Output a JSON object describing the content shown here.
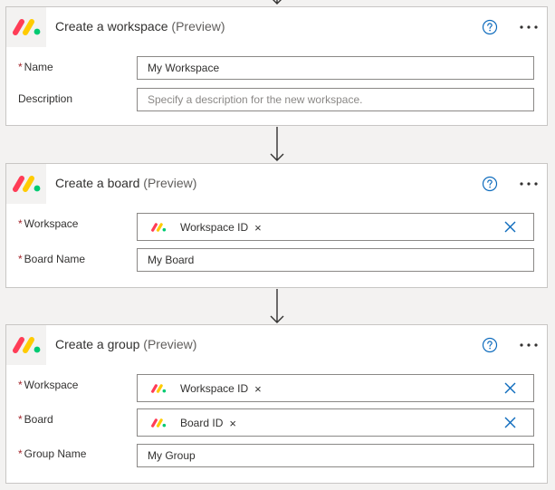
{
  "colors": {
    "accent": "#0f6cbd",
    "required": "#a4262c",
    "logo_red": "#ff3d57",
    "logo_yellow": "#ffcb00",
    "logo_green": "#00ca72"
  },
  "icons": {
    "logo": "monday-logo-icon",
    "help": "help-circle-icon",
    "more": "more-horizontal-icon",
    "clear": "clear-x-icon",
    "flow": "arrow-down-icon"
  },
  "cards": {
    "workspace": {
      "title": "Create a workspace",
      "tag": "(Preview)",
      "fields": {
        "name": {
          "label": "Name",
          "value": "My Workspace"
        },
        "description": {
          "label": "Description",
          "placeholder": "Specify a description for the new workspace."
        }
      }
    },
    "board": {
      "title": "Create a board",
      "tag": "(Preview)",
      "fields": {
        "workspace": {
          "label": "Workspace",
          "token": "Workspace ID"
        },
        "board_name": {
          "label": "Board Name",
          "value": "My Board"
        }
      }
    },
    "group": {
      "title": "Create a group",
      "tag": "(Preview)",
      "fields": {
        "workspace": {
          "label": "Workspace",
          "token": "Workspace ID"
        },
        "board": {
          "label": "Board",
          "token": "Board ID"
        },
        "group_name": {
          "label": "Group Name",
          "value": "My Group"
        }
      }
    }
  },
  "token_remove_symbol": "×",
  "required_marker": "*"
}
